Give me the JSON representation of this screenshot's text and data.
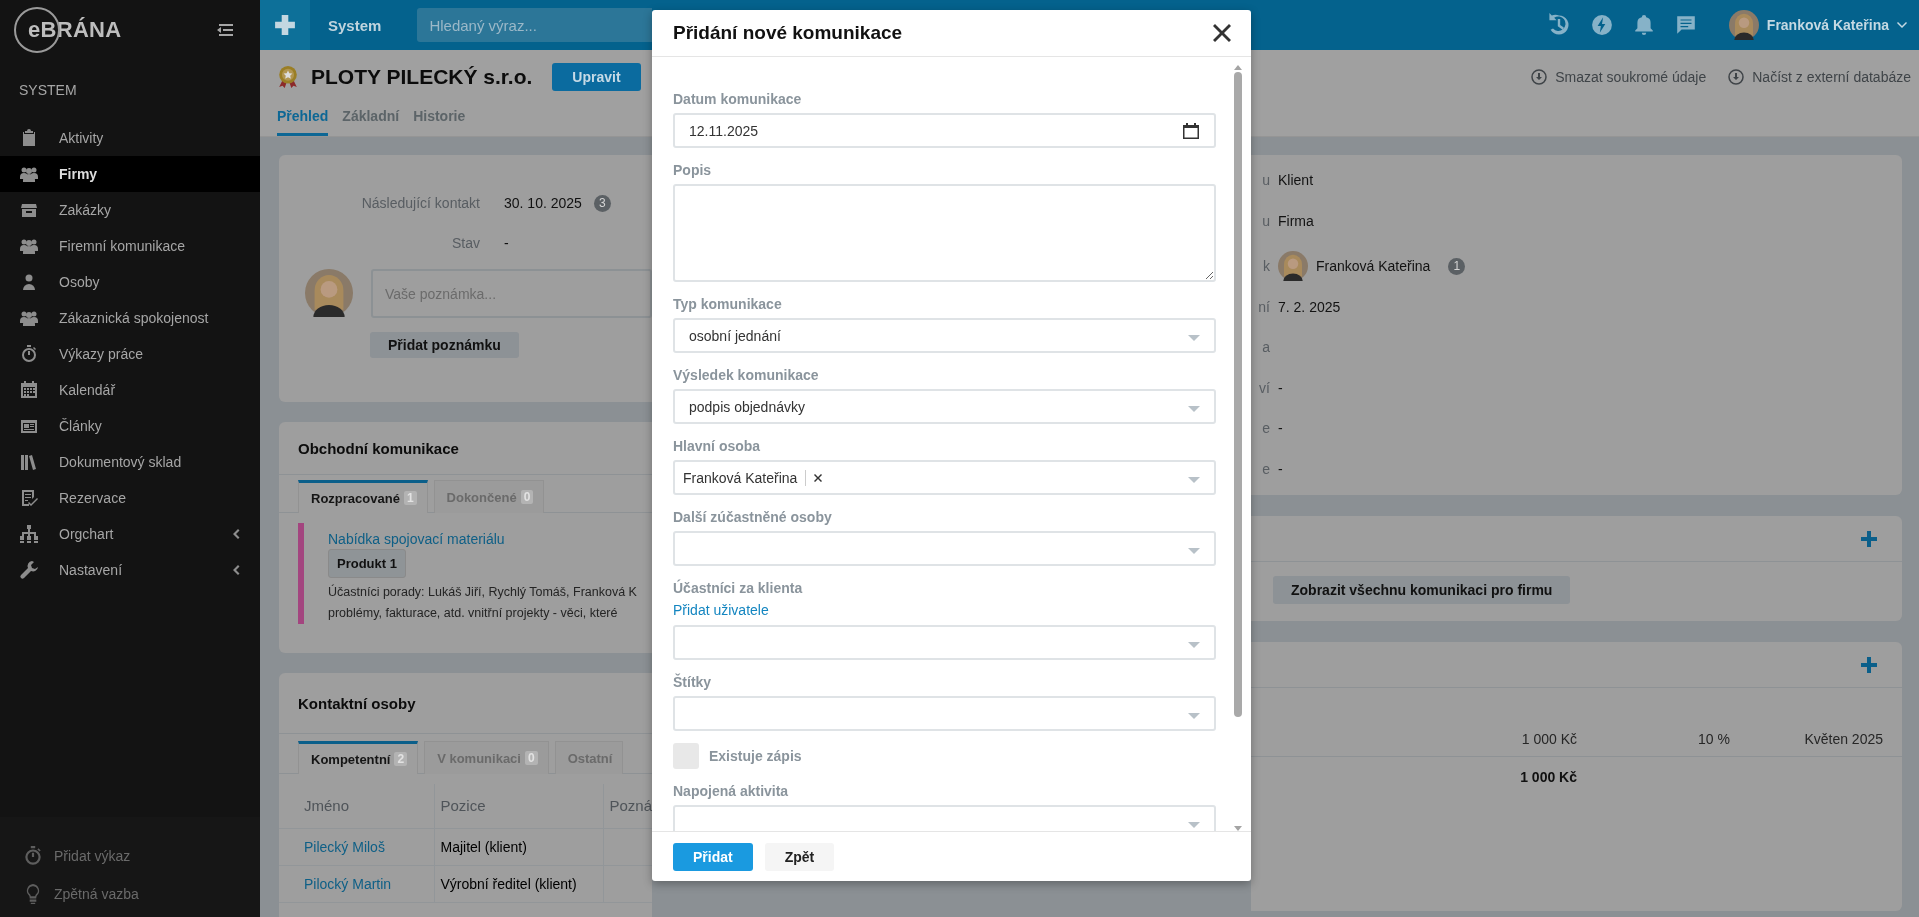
{
  "sidebar": {
    "logo": "eBRÁNA",
    "section": "SYSTEM",
    "items": [
      {
        "label": "Aktivity",
        "selected": false,
        "submenu": false
      },
      {
        "label": "Firmy",
        "selected": true,
        "submenu": false
      },
      {
        "label": "Zakázky",
        "selected": false,
        "submenu": false
      },
      {
        "label": "Firemní komunikace",
        "selected": false,
        "submenu": false
      },
      {
        "label": "Osoby",
        "selected": false,
        "submenu": false
      },
      {
        "label": "Zákaznická spokojenost",
        "selected": false,
        "submenu": false
      },
      {
        "label": "Výkazy práce",
        "selected": false,
        "submenu": false
      },
      {
        "label": "Kalendář",
        "selected": false,
        "submenu": false
      },
      {
        "label": "Články",
        "selected": false,
        "submenu": false
      },
      {
        "label": "Dokumentový sklad",
        "selected": false,
        "submenu": false
      },
      {
        "label": "Rezervace",
        "selected": false,
        "submenu": false
      },
      {
        "label": "Orgchart",
        "selected": false,
        "submenu": true
      },
      {
        "label": "Nastavení",
        "selected": false,
        "submenu": true
      }
    ],
    "footer": [
      "Přidat výkaz",
      "Zpětná vazba"
    ]
  },
  "topbar": {
    "section": "System",
    "search_placeholder": "Hledaný výraz...",
    "user": "Franková Kateřina"
  },
  "company": {
    "name": "PLOTY PILECKÝ s.r.o.",
    "edit_button": "Upravit",
    "tabs": [
      {
        "label": "Přehled",
        "selected": true
      },
      {
        "label": "Základní",
        "selected": false
      },
      {
        "label": "Historie",
        "selected": false
      }
    ],
    "actions": [
      "Smazat soukromé údaje",
      "Načíst z externí databáze"
    ]
  },
  "overview": {
    "next_contact_label": "Následující kontakt",
    "next_contact": "30. 10. 2025",
    "next_contact_count": "3",
    "status_label": "Stav",
    "status": "-",
    "note_placeholder": "Vaše poznámka...",
    "add_note_button": "Přidat poznámku"
  },
  "communication": {
    "title": "Obchodní komunikace",
    "tabs": [
      {
        "label": "Rozpracované",
        "count": "1",
        "selected": true
      },
      {
        "label": "Dokončené",
        "count": "0",
        "selected": false
      }
    ],
    "items": [
      {
        "color": "#a3457f",
        "title": "Nabídka spojovací materiálu",
        "tag": "Produkt 1",
        "lines": [
          "Účastníci porady: Lukáš Jiří, Rychlý Tomáš, Franková K",
          "problémy, fakturace, atd. vnitřní projekty - věci, které"
        ]
      }
    ]
  },
  "contacts": {
    "title": "Kontaktní osoby",
    "tabs": [
      {
        "label": "Kompetentní",
        "count": "2",
        "selected": true
      },
      {
        "label": "V komunikaci",
        "count": "0",
        "selected": false
      },
      {
        "label": "Ostatní",
        "selected": false
      }
    ],
    "columns": [
      "Jméno",
      "Pozice",
      "Pozná"
    ],
    "rows": [
      [
        "Pilecký Miloš",
        "Majitel (klient)"
      ],
      [
        "Pilocký Martin",
        "Výrobní ředitel (klient)"
      ]
    ]
  },
  "details": {
    "rows": [
      {
        "kind": "text",
        "label_tail": "u",
        "value": "Klient"
      },
      {
        "kind": "text",
        "label_tail": "u",
        "value": "Firma"
      },
      {
        "kind": "person",
        "label_tail": "k",
        "value": "Franková Kateřina",
        "count": "1"
      },
      {
        "kind": "text",
        "label_tail": "ní",
        "value": "7. 2. 2025"
      },
      {
        "kind": "text",
        "label_tail": "a"
      },
      {
        "kind": "text",
        "label_tail": "ví",
        "value": "-"
      },
      {
        "kind": "text",
        "label_tail": "e",
        "value": "-"
      },
      {
        "kind": "text",
        "label_tail": "e",
        "value": "-"
      }
    ]
  },
  "communication_card": {
    "show_all_button": "Zobrazit všechnu komunikaci pro firmu"
  },
  "products_card": {
    "rows": [
      [
        "1 000 Kč",
        "10 %",
        "Květen 2025"
      ]
    ],
    "total": "1 000 Kč"
  },
  "modal": {
    "title": "Přidání nové komunikace",
    "fields": [
      {
        "kind": "date",
        "label": "Datum komunikace",
        "value": "12.11.2025"
      },
      {
        "kind": "textarea",
        "label": "Popis"
      },
      {
        "kind": "select",
        "label": "Typ komunikace",
        "value": "osobní jednání"
      },
      {
        "kind": "select",
        "label": "Výsledek komunikace",
        "value": "podpis objednávky"
      },
      {
        "kind": "tags",
        "label": "Hlavní osoba",
        "tags": [
          "Franková Kateřina"
        ]
      },
      {
        "kind": "select",
        "label": "Další zúčastněné osoby"
      },
      {
        "kind": "select",
        "label": "Účastníci za klienta",
        "link": "Přidat uživatele"
      },
      {
        "kind": "select",
        "label": "Štítky"
      },
      {
        "kind": "checkbox",
        "label": "Existuje zápis",
        "checked": false
      },
      {
        "kind": "select",
        "label": "Napojená aktivita"
      }
    ],
    "buttons": [
      {
        "label": "Přidat",
        "primary": true
      },
      {
        "label": "Zpět",
        "primary": false
      }
    ]
  }
}
